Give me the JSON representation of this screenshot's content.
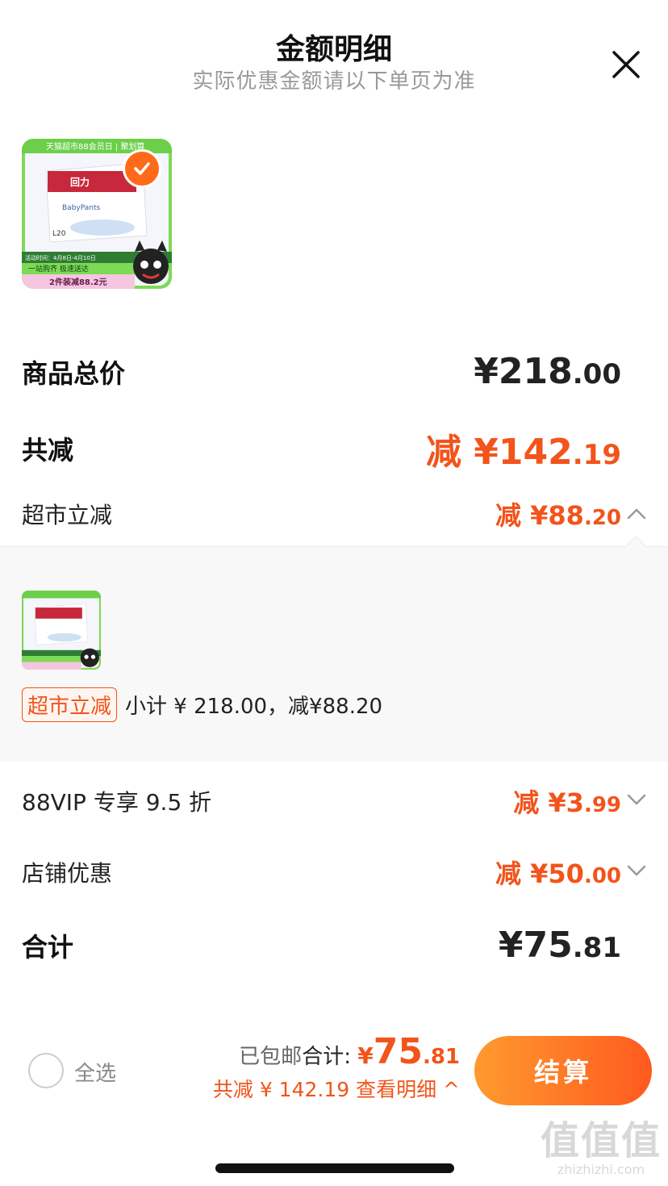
{
  "header": {
    "title": "金额明细",
    "subtitle": "实际优惠金额请以下单页为准"
  },
  "product": {
    "thumb_top_banner": "天猫超市88会员日 | 聚划算",
    "thumb_brand": "回力",
    "thumb_product_line": "BabyPants",
    "thumb_size": "L20",
    "thumb_activity": "活动时间：4月8日-4月10日",
    "thumb_slogan": "一站购齐 极速送达",
    "thumb_deal": "2件装减88.2元"
  },
  "summary_rows": {
    "total_label": "商品总价",
    "total_int": "¥218",
    "total_dec": ".00",
    "discount_label": "共减",
    "discount_int": "减 ¥142",
    "discount_dec": ".19",
    "market_label": "超市立减",
    "market_int": "减 ¥88",
    "market_dec": ".20",
    "vip_label": "88VIP 专享 9.5 折",
    "vip_int": "减 ¥3",
    "vip_dec": ".99",
    "store_label": "店铺优惠",
    "store_int": "减 ¥50",
    "store_dec": ".00",
    "sum_label": "合计",
    "sum_int": "¥75",
    "sum_dec": ".81"
  },
  "detail": {
    "tag": "超市立减",
    "text": "小计 ¥ 218.00，减¥88.20"
  },
  "bottom_bar": {
    "select_all": "全选",
    "shipping_label": "已包邮",
    "total_label": "合计:",
    "yen": "¥",
    "total_int": "75",
    "total_dec": ".81",
    "discount_line": "共减 ¥ 142.19  查看明细 ^",
    "checkout": "结算"
  },
  "watermark": {
    "logo": "值值值",
    "site": "zhizhizhi.com"
  },
  "colors": {
    "accent": "#f2541b",
    "button_gradient_start": "#ff9a2e",
    "button_gradient_end": "#ff5a1f",
    "panel_bg": "#f8f8f8"
  }
}
